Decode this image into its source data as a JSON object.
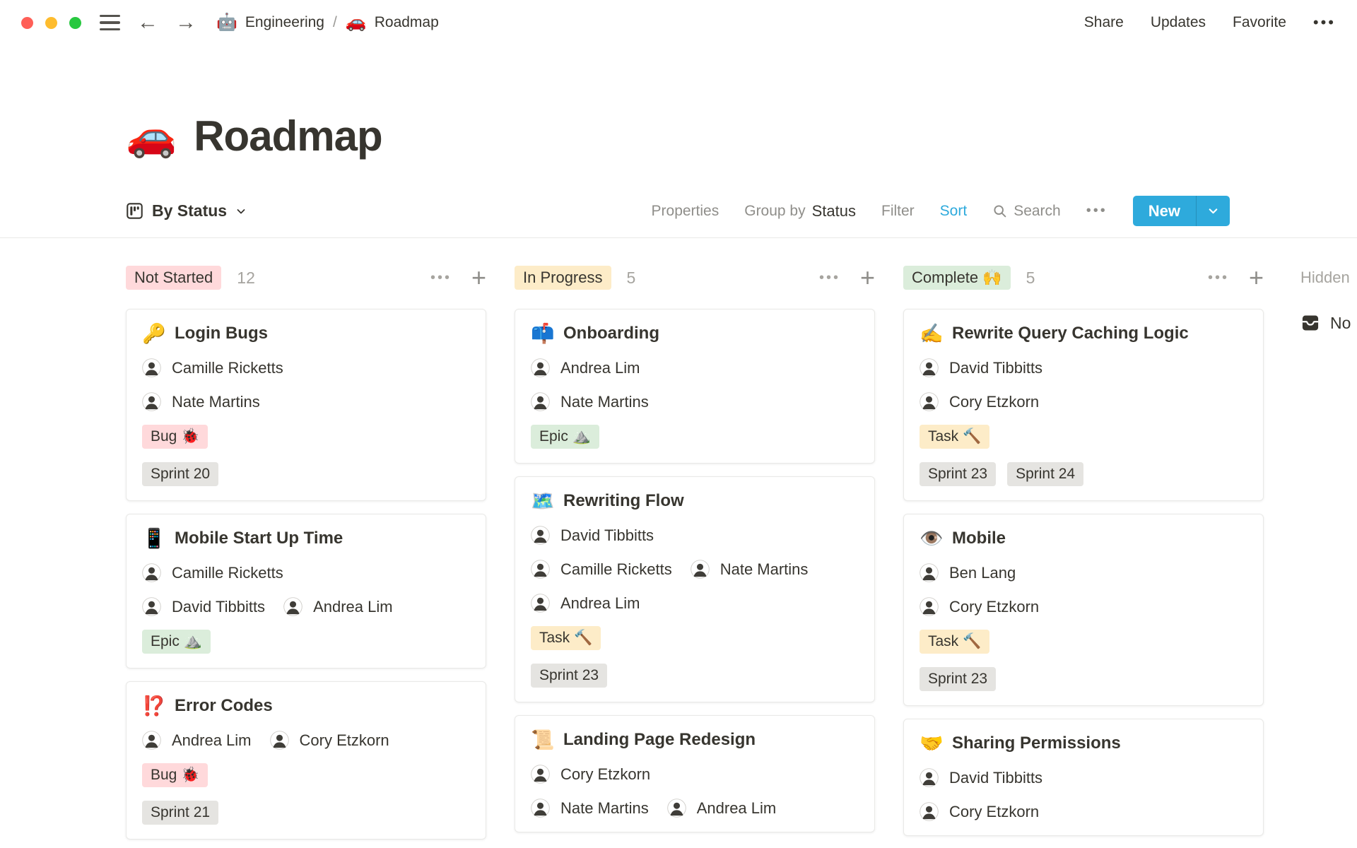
{
  "topbar": {
    "breadcrumb": [
      {
        "icon": "🤖",
        "label": "Engineering"
      },
      {
        "icon": "🚗",
        "label": "Roadmap"
      }
    ],
    "separator": "/",
    "actions": [
      "Share",
      "Updates",
      "Favorite"
    ],
    "more_glyph": "•••"
  },
  "page": {
    "icon": "🚗",
    "title": "Roadmap"
  },
  "toolbar": {
    "view_label": "By Status",
    "properties": "Properties",
    "group_by_prefix": "Group by",
    "group_by_value": "Status",
    "filter": "Filter",
    "sort": "Sort",
    "search": "Search",
    "more_glyph": "•••",
    "new_label": "New"
  },
  "board": {
    "more_glyph": "•••",
    "add_glyph": "+",
    "hidden_label": "Hidden",
    "hidden_group": {
      "icon": "inbox-tray",
      "label": "No"
    },
    "columns": [
      {
        "name": "Not Started",
        "count": "12",
        "badge_color": "#FFD9DB",
        "cards": [
          {
            "icon": "🔑",
            "title": "Login Bugs",
            "person_rows": [
              [
                "Camille Ricketts"
              ],
              [
                "Nate Martins"
              ]
            ],
            "tag_rows": [
              [
                {
                  "label": "Bug 🐞",
                  "color": "#FFD9DB"
                }
              ],
              [
                {
                  "label": "Sprint 20",
                  "color": "#E5E4E1"
                }
              ]
            ]
          },
          {
            "icon": "📱",
            "title": "Mobile Start Up Time",
            "person_rows": [
              [
                "Camille Ricketts"
              ],
              [
                "David Tibbitts",
                "Andrea Lim"
              ]
            ],
            "tag_rows": [
              [
                {
                  "label": "Epic ⛰️",
                  "color": "#DBEDDB"
                }
              ]
            ]
          },
          {
            "icon": "⁉️",
            "title": "Error Codes",
            "person_rows": [
              [
                "Andrea Lim",
                "Cory Etzkorn"
              ]
            ],
            "tag_rows": [
              [
                {
                  "label": "Bug 🐞",
                  "color": "#FFD9DB"
                }
              ],
              [
                {
                  "label": "Sprint 21",
                  "color": "#E5E4E1"
                }
              ]
            ]
          }
        ]
      },
      {
        "name": "In Progress",
        "count": "5",
        "badge_color": "#FDECC8",
        "cards": [
          {
            "icon": "📫",
            "title": "Onboarding",
            "person_rows": [
              [
                "Andrea Lim"
              ],
              [
                "Nate Martins"
              ]
            ],
            "tag_rows": [
              [
                {
                  "label": "Epic ⛰️",
                  "color": "#DBEDDB"
                }
              ]
            ]
          },
          {
            "icon": "🗺️",
            "title": "Rewriting Flow",
            "person_rows": [
              [
                "David Tibbitts"
              ],
              [
                "Camille Ricketts",
                "Nate Martins"
              ],
              [
                "Andrea Lim"
              ]
            ],
            "tag_rows": [
              [
                {
                  "label": "Task 🔨",
                  "color": "#FDECC8"
                }
              ],
              [
                {
                  "label": "Sprint 23",
                  "color": "#E5E4E1"
                }
              ]
            ]
          },
          {
            "icon": "📜",
            "title": "Landing Page Redesign",
            "person_rows": [
              [
                "Cory Etzkorn"
              ],
              [
                "Nate Martins",
                "Andrea Lim"
              ]
            ],
            "tag_rows": []
          }
        ]
      },
      {
        "name": "Complete 🙌",
        "count": "5",
        "badge_color": "#DBEDDB",
        "cards": [
          {
            "icon": "✍️",
            "title": "Rewrite Query Caching Logic",
            "person_rows": [
              [
                "David Tibbitts"
              ],
              [
                "Cory Etzkorn"
              ]
            ],
            "tag_rows": [
              [
                {
                  "label": "Task 🔨",
                  "color": "#FDECC8"
                }
              ],
              [
                {
                  "label": "Sprint 23",
                  "color": "#E5E4E1"
                },
                {
                  "label": "Sprint 24",
                  "color": "#E5E4E1"
                }
              ]
            ]
          },
          {
            "icon": "👁️",
            "title": "Mobile",
            "person_rows": [
              [
                "Ben Lang"
              ],
              [
                "Cory Etzkorn"
              ]
            ],
            "tag_rows": [
              [
                {
                  "label": "Task 🔨",
                  "color": "#FDECC8"
                }
              ],
              [
                {
                  "label": "Sprint 23",
                  "color": "#E5E4E1"
                }
              ]
            ]
          },
          {
            "icon": "🤝",
            "title": "Sharing Permissions",
            "person_rows": [
              [
                "David Tibbitts"
              ],
              [
                "Cory Etzkorn"
              ]
            ],
            "tag_rows": []
          }
        ]
      }
    ]
  },
  "colors": {
    "accent_blue": "#2EAADC",
    "text": "#37352F",
    "text_gray": "#8F8E8A",
    "tag_red": "#FFD9DB",
    "tag_yellow": "#FDECC8",
    "tag_green": "#DBEDDB",
    "tag_gray": "#E5E4E1",
    "traffic_red": "#FF5F57",
    "traffic_yellow": "#FEBC2E",
    "traffic_green": "#28C840"
  }
}
